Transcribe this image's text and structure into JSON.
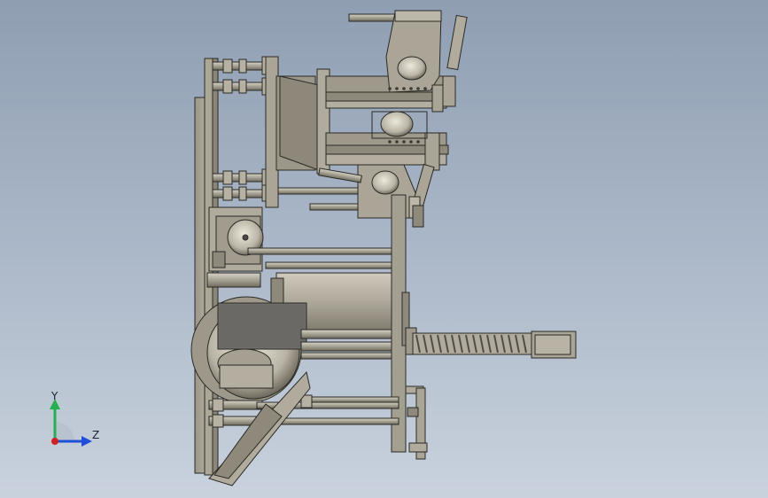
{
  "viewport": {
    "background_top": "#8f9eb2",
    "background_bottom": "#c9d2dd"
  },
  "model": {
    "part_color": "#a19c8e",
    "part_shade": "#8a8577",
    "part_dark": "#5f5b50",
    "motor_color": "#6f6e6a",
    "spring_color": "#4f4d48"
  },
  "triad": {
    "x_label": "",
    "y_label": "Y",
    "z_label": "Z",
    "y_color": "#22b14c",
    "z_color": "#1f4fd8",
    "x_color": "#d42020"
  }
}
